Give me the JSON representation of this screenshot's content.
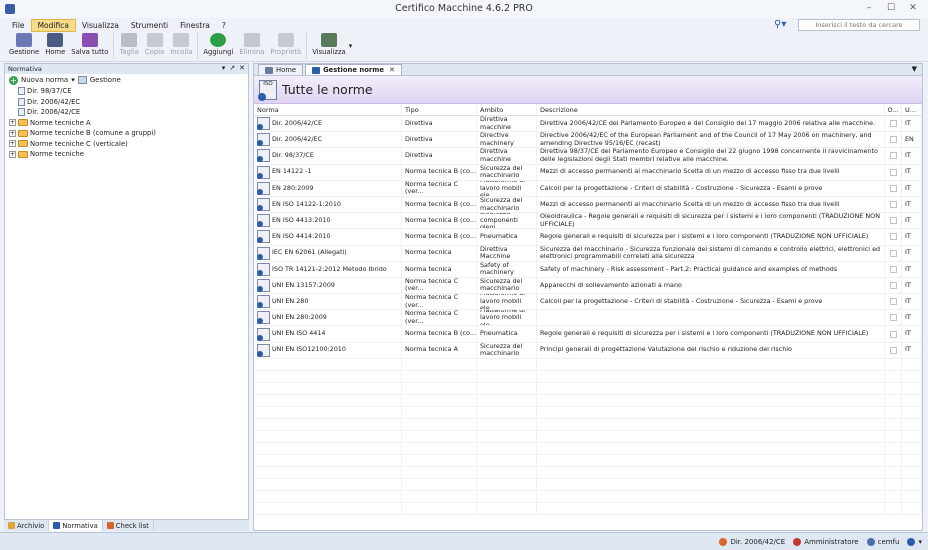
{
  "window": {
    "title": "Certifico Macchine 4.6.2 PRO"
  },
  "menu": [
    "File",
    "Modifica",
    "Visualizza",
    "Strumenti",
    "Finestra",
    "?"
  ],
  "search": {
    "placeholder": "Inserisci il testo da cercare"
  },
  "toolbar": [
    {
      "label": "Gestione",
      "icon": "gestione-icon",
      "enabled": true,
      "color": "#6b76b3"
    },
    {
      "label": "Home",
      "icon": "home-icon",
      "enabled": true,
      "color": "#4a5a80"
    },
    {
      "label": "Salva tutto",
      "icon": "save-all-icon",
      "enabled": true,
      "color": "#8a4fb0"
    },
    {
      "label": "Taglia",
      "icon": "cut-icon",
      "enabled": false,
      "color": "#b9bec6"
    },
    {
      "label": "Copia",
      "icon": "copy-icon",
      "enabled": false,
      "color": "#c6cad0"
    },
    {
      "label": "Incolla",
      "icon": "paste-icon",
      "enabled": false,
      "color": "#c6cad0"
    },
    {
      "label": "Aggiungi",
      "icon": "add-icon",
      "enabled": true,
      "color": "#2f9e4b"
    },
    {
      "label": "Elimina",
      "icon": "delete-icon",
      "enabled": false,
      "color": "#c4c8cf"
    },
    {
      "label": "Proprietà",
      "icon": "properties-icon",
      "enabled": false,
      "color": "#c6cad0"
    },
    {
      "label": "Visualizza",
      "icon": "view-icon",
      "enabled": true,
      "color": "#5a7a5a"
    }
  ],
  "left_panel": {
    "title": "Normativa",
    "new_label": "Nuova norma",
    "manage_label": "Gestione",
    "tree": [
      {
        "label": "Dir. 98/37/CE",
        "type": "doc",
        "expandable": false
      },
      {
        "label": "Dir. 2006/42/EC",
        "type": "doc",
        "expandable": false
      },
      {
        "label": "Dir. 2006/42/CE",
        "type": "doc",
        "expandable": false
      },
      {
        "label": "Norme tecniche A",
        "type": "folder",
        "expandable": true
      },
      {
        "label": "Norme tecniche B (comune a gruppi)",
        "type": "folder",
        "expandable": true
      },
      {
        "label": "Norme tecniche C (verticale)",
        "type": "folder",
        "expandable": true
      },
      {
        "label": "Norme tecniche",
        "type": "folder",
        "expandable": true
      }
    ],
    "tabs": [
      {
        "label": "Archivio",
        "active": false
      },
      {
        "label": "Normativa",
        "active": true
      },
      {
        "label": "Check list",
        "active": false
      }
    ]
  },
  "doc_tabs": [
    {
      "label": "Home",
      "active": false
    },
    {
      "label": "Gestione norme",
      "active": true
    }
  ],
  "page": {
    "title": "Tutte le norme",
    "icon_label": "ISO"
  },
  "table": {
    "columns": [
      "Norma",
      "Tipo",
      "Ambito",
      "Descrizione",
      "O...",
      "U..."
    ],
    "rows": [
      {
        "norma": "Dir. 2006/42/CE",
        "tipo": "Direttiva",
        "ambito": "Direttiva macchine",
        "descrizione": "Direttiva 2006/42/CE del Parlamento Europeo e del Consiglio del 17 maggio 2006 relativa alle macchine.",
        "lang": "IT"
      },
      {
        "norma": "Dir. 2006/42/EC",
        "tipo": "Direttiva",
        "ambito": "Directive machinery",
        "descrizione": "Directive 2006/42/EC of the European Parliament and of the Council of 17 May 2006 on machinery, and amending Directive 95/16/EC (recast)",
        "lang": "EN"
      },
      {
        "norma": "Dir. 98/37/CE",
        "tipo": "Direttiva",
        "ambito": "Direttiva macchine",
        "descrizione": "Direttiva 98/37/CE del Parlamento Europeo e Consiglio del 22 giugno 1998 concernente il ravvicinamento delle legislazioni degli Stati membri relative alle macchine.",
        "lang": "IT"
      },
      {
        "norma": "EN 14122 -1",
        "tipo": "Norma tecnica B (co...",
        "ambito": "Sicurezza del macchinario",
        "descrizione": "Mezzi di accesso permanenti al macchinario Scelta di un mezzo di accesso fisso tra due livelli",
        "lang": "IT"
      },
      {
        "norma": "EN 280:2009",
        "tipo": "Norma tecnica C (ver...",
        "ambito": "Piattaforme di lavoro mobili ele...",
        "descrizione": "Calcoli per la progettazione - Criteri di stabilità - Costruzione - Sicurezza - Esami e prove",
        "lang": "IT"
      },
      {
        "norma": "EN ISO 14122-1:2010",
        "tipo": "Norma tecnica B (co...",
        "ambito": "Sicurezza del macchinario",
        "descrizione": "Mezzi di accesso permanenti al macchinario Scelta di un mezzo di accesso fisso tra due livelli",
        "lang": "IT"
      },
      {
        "norma": "EN ISO 4413:2010",
        "tipo": "Norma tecnica B (co...",
        "ambito": "Sicurezza componenti oleoi...",
        "descrizione": "Oleoidraulica - Regole generali e requisiti di sicurezza per i sistemi e i loro componenti (TRADUZIONE NON UFFICIALE)",
        "lang": "IT"
      },
      {
        "norma": "EN ISO 4414:2010",
        "tipo": "Norma tecnica B (co...",
        "ambito": "Pneumatica",
        "descrizione": "Regole generali e requisiti di sicurezza per i sistemi e i loro componenti (TRADUZIONE NON UFFICIALE)",
        "lang": "IT"
      },
      {
        "norma": "IEC EN 62061 (Allegati)",
        "tipo": "Norma tecnica",
        "ambito": "Direttiva Macchine",
        "descrizione": "Sicurezza del macchinario - Sicurezza funzionale dei sistemi di comando e controllo elettrici, elettronici ed elettronici programmabili correlati alla sicurezza",
        "lang": "IT"
      },
      {
        "norma": "ISO TR 14121-2:2012 Metodo Ibrido",
        "tipo": "Norma tecnica",
        "ambito": "Safety of machinery",
        "descrizione": "Safety of machinery - Risk assessment - Part.2: Practical guidance and examples of methods",
        "lang": "IT"
      },
      {
        "norma": "UNI EN 13157:2009",
        "tipo": "Norma tecnica C (ver...",
        "ambito": "Sicurezza del macchinario",
        "descrizione": "Apparecchi di sollevamento azionati a mano",
        "lang": "IT"
      },
      {
        "norma": "UNI EN 280",
        "tipo": "Norma tecnica C (ver...",
        "ambito": "Piattaforme di lavoro mobili ele...",
        "descrizione": "Calcoli per la progettazione - Criteri di stabilità - Costruzione - Sicurezza - Esami e prove",
        "lang": "IT"
      },
      {
        "norma": "UNI EN 280:2009",
        "tipo": "Norma tecnica C (ver...",
        "ambito": "Piattaforme di lavoro mobili ele...",
        "descrizione": "",
        "lang": "IT"
      },
      {
        "norma": "UNI EN ISO 4414",
        "tipo": "Norma tecnica B (co...",
        "ambito": "Pneumatica",
        "descrizione": "Regole generali e requisiti di sicurezza per i sistemi e i loro componenti (TRADUZIONE NON UFFICIALE)",
        "lang": "IT"
      },
      {
        "norma": "UNI EN ISO12100:2010",
        "tipo": "Norma tecnica A",
        "ambito": "Sicurezza del macchinario",
        "descrizione": "Principi generali di progettazione Valutazione del rischio e riduzione del rischio",
        "lang": "IT"
      }
    ]
  },
  "status": {
    "document": "Dir. 2006/42/CE",
    "user": "Amministratore",
    "connection": "cemfu"
  },
  "colors": {
    "accent": "#2a5da8",
    "header_purple": "#e0d4f3",
    "menu_active": "#f7dc8a"
  }
}
